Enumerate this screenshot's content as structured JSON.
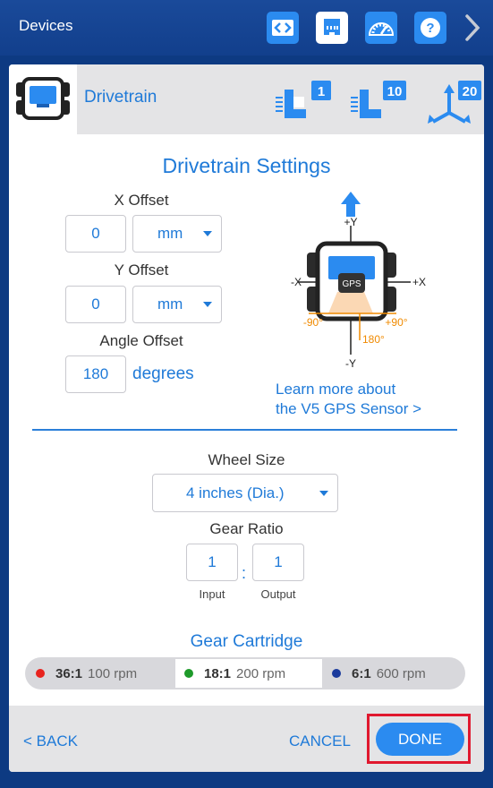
{
  "topbar": {
    "title": "Devices"
  },
  "device": {
    "name": "Drivetrain"
  },
  "header_icons": {
    "motor_1": "1",
    "motor_10": "10",
    "motor_20": "20"
  },
  "settings": {
    "title": "Drivetrain Settings",
    "x_offset": {
      "label": "X Offset",
      "value": "0",
      "unit": "mm"
    },
    "y_offset": {
      "label": "Y Offset",
      "value": "0",
      "unit": "mm"
    },
    "angle_offset": {
      "label": "Angle Offset",
      "value": "180",
      "unit": "degrees"
    }
  },
  "diagram": {
    "plus_y": "+Y",
    "minus_y": "-Y",
    "plus_x": "+X",
    "minus_x": "-X",
    "gps": "GPS",
    "neg90": "-90°",
    "pos90": "+90°",
    "deg180": "180°"
  },
  "learn_more": {
    "line1": "Learn more about",
    "line2": "the V5 GPS Sensor >"
  },
  "wheel": {
    "label": "Wheel Size",
    "value": "4 inches (Dia.)"
  },
  "gear_ratio": {
    "label": "Gear Ratio",
    "input_value": "1",
    "output_value": "1",
    "input_label": "Input",
    "output_label": "Output",
    "separator": ":"
  },
  "gear_cartridge": {
    "title": "Gear Cartridge",
    "options": [
      {
        "ratio": "36:1",
        "rpm": "100 rpm",
        "color": "#e8231e"
      },
      {
        "ratio": "18:1",
        "rpm": "200 rpm",
        "color": "#1e9a2a"
      },
      {
        "ratio": "6:1",
        "rpm": "600 rpm",
        "color": "#1a3a9c"
      }
    ],
    "selected": "18:1"
  },
  "footer": {
    "back": "< BACK",
    "cancel": "CANCEL",
    "done": "DONE"
  },
  "colors": {
    "accent": "#2b8bf0",
    "text_blue": "#1f7ad8",
    "topbar": "#123f8c",
    "highlight": "#e0182f"
  }
}
